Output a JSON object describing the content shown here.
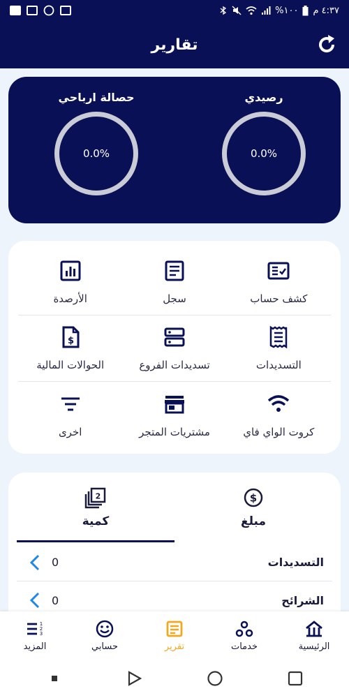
{
  "status_bar": {
    "time": "٤:٣٧ م",
    "battery": "%١٠٠"
  },
  "app_bar": {
    "title": "تقارير"
  },
  "balance_card": {
    "gauges": [
      {
        "label": "رصيدي",
        "value": "0.0%"
      },
      {
        "label": "حصالة ارباحي",
        "value": "0.0%"
      }
    ]
  },
  "menu": {
    "items": [
      {
        "label": "كشف حساب",
        "icon": "account-statement-icon"
      },
      {
        "label": "سجل",
        "icon": "log-icon"
      },
      {
        "label": "الأرصدة",
        "icon": "balances-chart-icon"
      },
      {
        "label": "التسديدات",
        "icon": "receipt-icon"
      },
      {
        "label": "تسديدات الفروع",
        "icon": "server-storage-icon"
      },
      {
        "label": "الحوالات المالية",
        "icon": "money-document-icon"
      },
      {
        "label": "كروت الواي فاي",
        "icon": "wifi-icon"
      },
      {
        "label": "مشتريات المتجر",
        "icon": "store-icon"
      },
      {
        "label": "اخرى",
        "icon": "filter-lines-icon"
      }
    ]
  },
  "tabs": [
    {
      "label": "مبلغ",
      "icon": "dollar-circle-icon",
      "active": false
    },
    {
      "label": "كمية",
      "icon": "stack-number-icon",
      "active": true
    }
  ],
  "list": [
    {
      "name": "التسديدات",
      "value": "0"
    },
    {
      "name": "الشرائح",
      "value": "0"
    }
  ],
  "bottom_nav": [
    {
      "label": "الرئيسية",
      "icon": "home-icon",
      "active": false
    },
    {
      "label": "خدمات",
      "icon": "services-icon",
      "active": false
    },
    {
      "label": "تقرير",
      "icon": "report-icon",
      "active": true
    },
    {
      "label": "حسابي",
      "icon": "smiley-icon",
      "active": false
    },
    {
      "label": "المزيد",
      "icon": "more-list-icon",
      "active": false
    }
  ],
  "colors": {
    "primary": "#0a1055",
    "accent": "#f2a81e",
    "chevron": "#1e88e5",
    "background": "#eef4fb"
  }
}
